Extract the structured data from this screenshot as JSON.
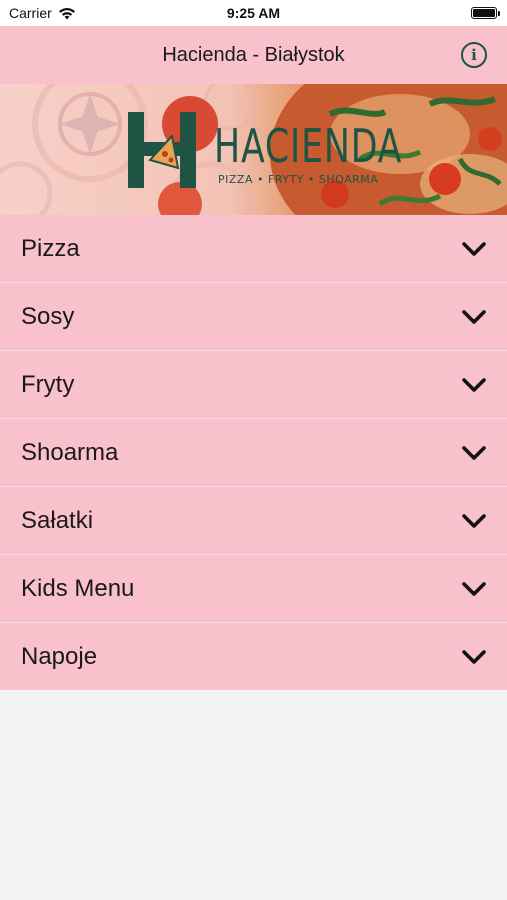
{
  "status_bar": {
    "carrier": "Carrier",
    "time": "9:25 AM"
  },
  "nav": {
    "title": "Hacienda - Białystok",
    "info_icon": "info-circle-icon"
  },
  "banner": {
    "logo_text": "HACIENDA",
    "logo_tagline": "PIZZA • FRYTY • SHOARMA",
    "colors": {
      "logo_green": "#1f5444",
      "background_pink": "#f7d1c9"
    }
  },
  "categories": [
    {
      "label": "Pizza"
    },
    {
      "label": "Sosy"
    },
    {
      "label": "Fryty"
    },
    {
      "label": "Shoarma"
    },
    {
      "label": "Sałatki"
    },
    {
      "label": "Kids Menu"
    },
    {
      "label": "Napoje"
    }
  ],
  "colors": {
    "accent_pink": "#f8c1cb",
    "page_background": "#f2f1f3",
    "separator": "#f1dfe3"
  }
}
